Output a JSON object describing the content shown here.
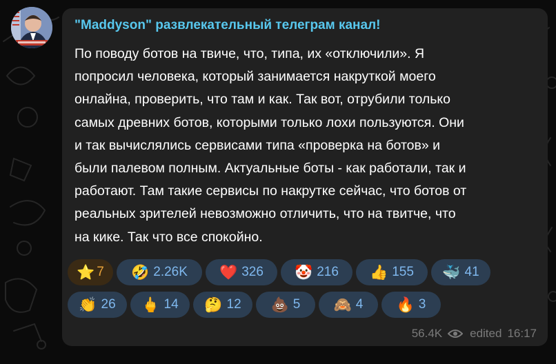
{
  "channel": {
    "name": "\"Maddyson\" развлекательный телеграм канал!"
  },
  "message": {
    "lines": [
      "По поводу ботов на твиче, что, типа, их «отключили». Я",
      "попросил человека, который занимается накруткой моего",
      "онлайна, проверить, что там и как. Так вот, отрубили только",
      "самых древних ботов, которыми только лохи пользуются. Они",
      "и так вычислялись сервисами типа «проверка на ботов» и",
      "были палевом полным. Актуальные боты - как работали, так и",
      "работают. Там такие сервисы по накрутке сейчас, что ботов от",
      "реальных зрителей невозможно отличить, что на твитче, что",
      "на кике. Так что все спокойно."
    ]
  },
  "reactions": [
    {
      "icon": "star-icon",
      "emoji": "⭐",
      "count": "7",
      "active": true
    },
    {
      "icon": "rofl-emoji-icon",
      "emoji": "🤣",
      "count": "2.26K"
    },
    {
      "icon": "heart-icon",
      "emoji": "❤️",
      "count": "326"
    },
    {
      "icon": "clown-emoji-icon",
      "emoji": "🤡",
      "count": "216"
    },
    {
      "icon": "thumbs-up-icon",
      "emoji": "👍",
      "count": "155"
    },
    {
      "icon": "whale-emoji-icon",
      "emoji": "🐳",
      "count": "41"
    },
    {
      "icon": "clapping-hands-icon",
      "emoji": "👏",
      "count": "26"
    },
    {
      "icon": "middle-finger-icon",
      "emoji": "🖕",
      "count": "14"
    },
    {
      "icon": "thinking-face-icon",
      "emoji": "🤔",
      "count": "12"
    },
    {
      "icon": "poop-icon",
      "emoji": "💩",
      "count": "5"
    },
    {
      "icon": "see-no-evil-monkey-icon",
      "emoji": "🙈",
      "count": "4"
    },
    {
      "icon": "fire-icon",
      "emoji": "🔥",
      "count": "3"
    }
  ],
  "meta": {
    "views": "56.4K",
    "edited_label": "edited",
    "time": "16:17"
  },
  "colors": {
    "background": "#0b0b0b",
    "bubble": "#212121",
    "channel_name": "#58c8ee",
    "reaction_bg": "#2c3e52",
    "reaction_text": "#7fb8ee",
    "paid_reaction_bg": "#3a2a14",
    "paid_reaction_text": "#e8a33a",
    "meta_text": "#7a7a7a"
  }
}
